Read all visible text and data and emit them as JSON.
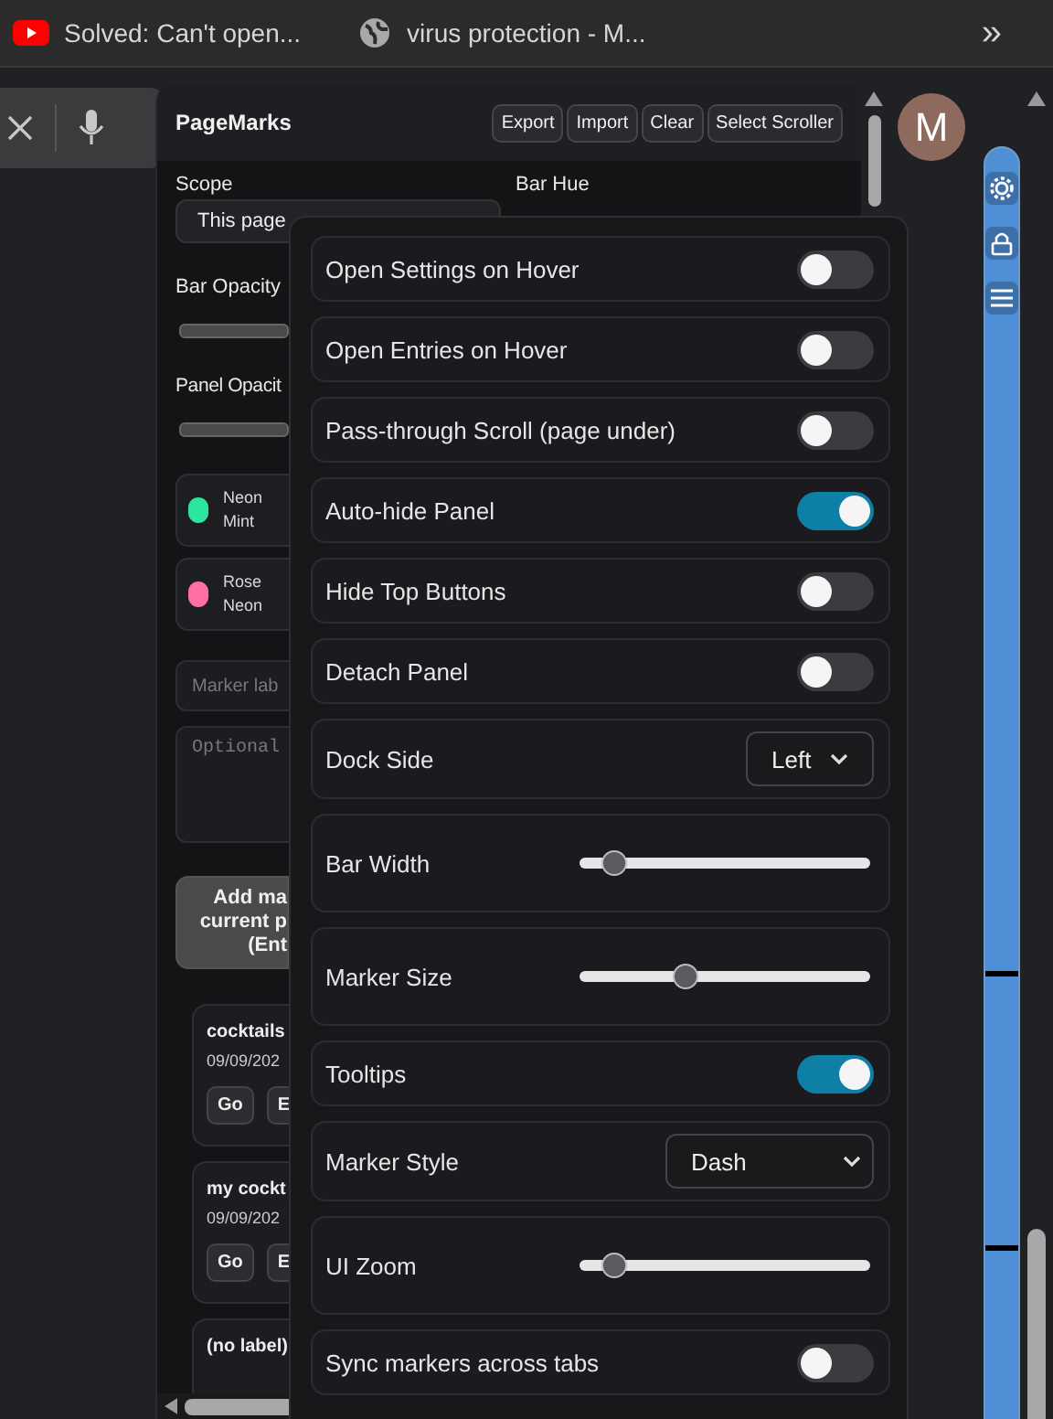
{
  "browser_tabs": [
    {
      "kind": "video",
      "title": "Solved: Can't open..."
    },
    {
      "kind": "globe",
      "title": "virus protection - M..."
    }
  ],
  "tab_overflow": "»",
  "profile": {
    "initial": "M"
  },
  "panel": {
    "title": "PageMarks",
    "actions": [
      "Export",
      "Import",
      "Clear",
      "Select Scroller"
    ],
    "scope": {
      "label": "Scope",
      "value": "This page"
    },
    "bar_hue": {
      "label": "Bar Hue"
    },
    "bar_opacity": {
      "label": "Bar Opacity"
    },
    "panel_opacity": {
      "label": "Panel Opacit"
    },
    "colors": [
      {
        "name": "Neon Mint",
        "color": "#2ee59d"
      },
      {
        "name": "Rose Neon",
        "color": "#ff6fa3"
      }
    ],
    "marker_label": {
      "placeholder": "Marker lab"
    },
    "note": {
      "placeholder": "Optional"
    },
    "add_button": [
      "Add ma",
      "current p",
      "(Ent"
    ],
    "entries": [
      {
        "title": "cocktails",
        "date": "09/09/202",
        "actions": [
          "Go",
          "E"
        ]
      },
      {
        "title": "my cockt",
        "date": "09/09/202",
        "actions": [
          "Go",
          "E"
        ]
      },
      {
        "title": "(no label)"
      }
    ]
  },
  "settings": [
    {
      "kind": "toggle",
      "label": "Open Settings on Hover",
      "on": false
    },
    {
      "kind": "toggle",
      "label": "Open Entries on Hover",
      "on": false
    },
    {
      "kind": "toggle",
      "label": "Pass-through Scroll (page under)",
      "on": false
    },
    {
      "kind": "toggle",
      "label": "Auto-hide Panel",
      "on": true
    },
    {
      "kind": "toggle",
      "label": "Hide Top Buttons",
      "on": false
    },
    {
      "kind": "toggle",
      "label": "Detach Panel",
      "on": false
    },
    {
      "kind": "select",
      "label": "Dock Side",
      "value": "Left"
    },
    {
      "kind": "slider",
      "label": "Bar Width",
      "level": 0.08
    },
    {
      "kind": "slider",
      "label": "Marker Size",
      "level": 0.35
    },
    {
      "kind": "toggle",
      "label": "Tooltips",
      "on": true
    },
    {
      "kind": "select",
      "label": "Marker Style",
      "value": "Dash"
    },
    {
      "kind": "slider",
      "label": "UI Zoom",
      "level": 0.08
    },
    {
      "kind": "toggle",
      "label": "Sync markers across tabs",
      "on": false
    }
  ]
}
